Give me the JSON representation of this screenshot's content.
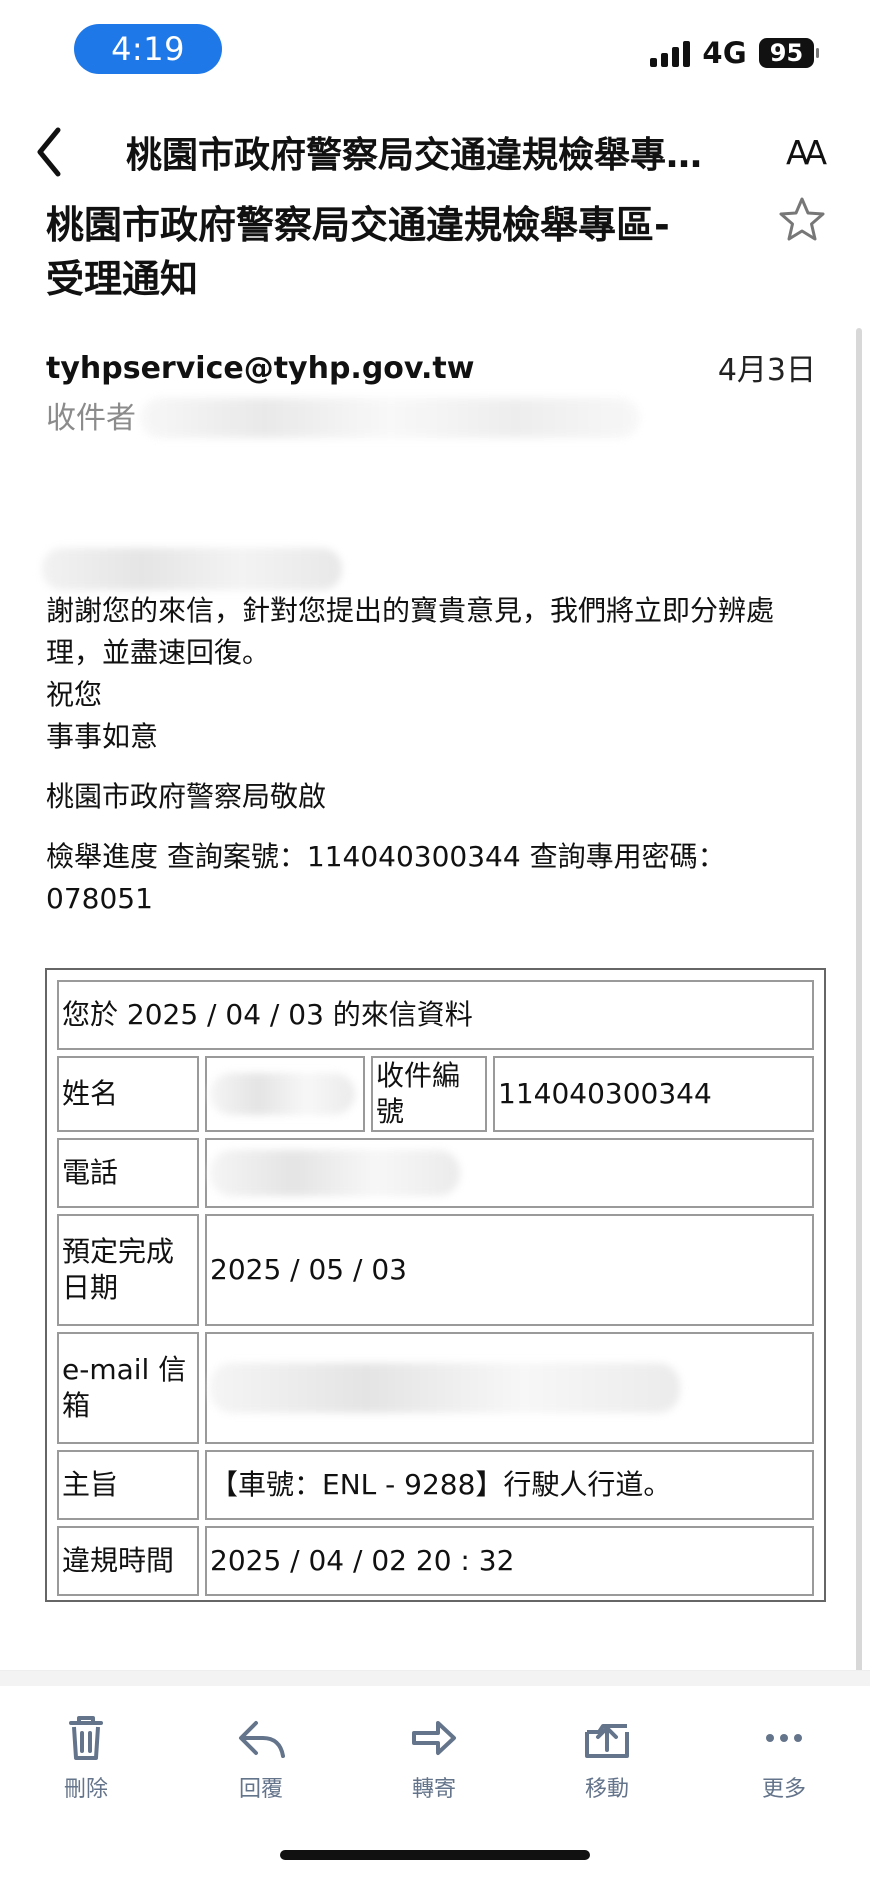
{
  "status_bar": {
    "time": "4:19",
    "network": "4G",
    "battery": "95"
  },
  "navigation": {
    "title": "桃園市政府警察局交通違規檢舉專區-受理通知",
    "back_icon": "chevron-left-icon",
    "font_size_label": "AA"
  },
  "message": {
    "subject_line1": "桃園市政府警察局交通違規檢舉專區-",
    "subject_line2": "受理通知",
    "sender": "tyhpservice@tyhp.gov.tw",
    "date": "4月3日",
    "recipient_label": "收件者"
  },
  "body": {
    "line1": "謝謝您的來信，針對您提出的寶貴意見，我們將立即分辨處",
    "line2": "理，並盡速回復。",
    "line3": "祝您",
    "line4": "事事如意",
    "signature": "桃園市政府警察局敬啟",
    "progress_line1": "檢舉進度 查詢案號：114040300344 查詢專用密碼：",
    "progress_line2": "078051"
  },
  "info_table": {
    "header": "您於 2025 / 04 / 03 的來信資料",
    "name_label": "姓名",
    "receipt_label": "收件編號",
    "receipt_value": "114040300344",
    "phone_label": "電話",
    "due_label": "預定完成日期",
    "due_value": "2025 / 05 / 03",
    "email_label": "e-mail 信箱",
    "subject_label": "主旨",
    "subject_value": "【車號：ENL - 9288】行駛人行道。",
    "violation_time_label": "違規時間",
    "violation_time_value": "2025 / 04 / 02 20 : 32"
  },
  "toolbar": {
    "delete": "刪除",
    "reply": "回覆",
    "forward": "轉寄",
    "move": "移動",
    "more": "更多"
  },
  "colors": {
    "time_pill": "#1f78e8",
    "toolbar_icon": "#64748b",
    "muted_text": "#8b8b8b",
    "table_border": "#9a9a9a"
  },
  "icons": {
    "star": "star-outline-icon",
    "delete": "trash-icon",
    "reply": "reply-icon",
    "forward": "forward-arrow-icon",
    "move": "move-folder-icon",
    "more": "more-dots-icon"
  }
}
